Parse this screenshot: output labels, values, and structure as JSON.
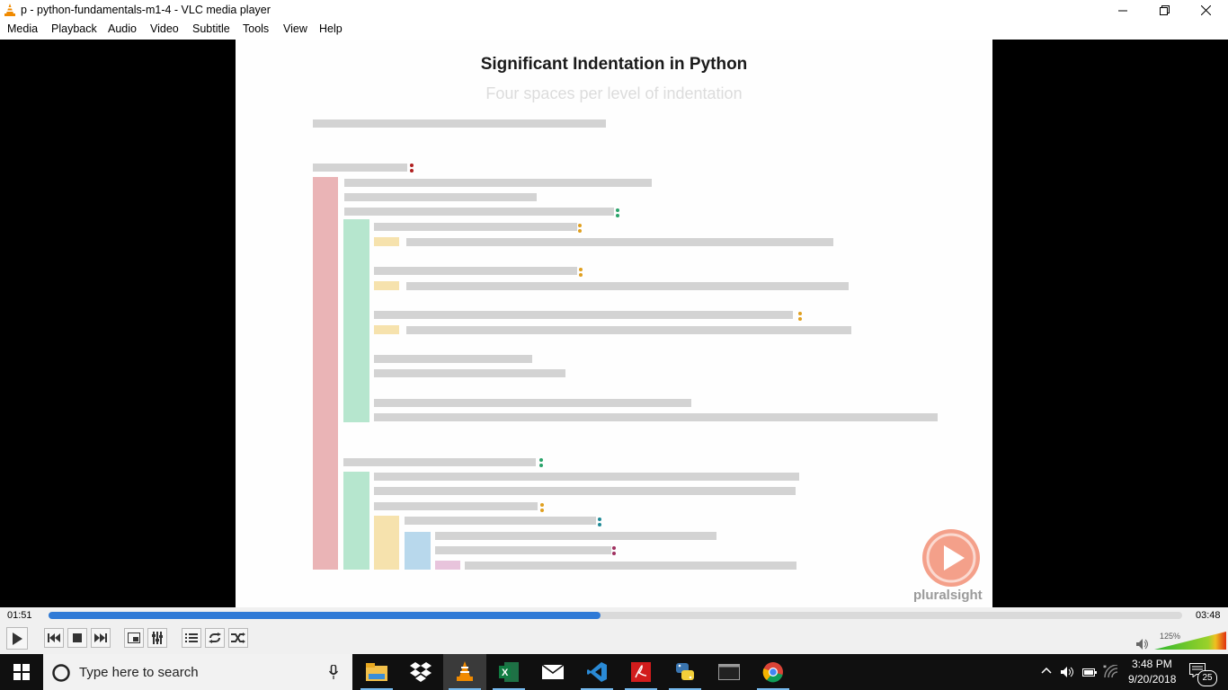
{
  "window": {
    "title": "p - python-fundamentals-m1-4 - VLC media player",
    "logo_icon": "vlc-cone-icon",
    "buttons": [
      "minimize-icon",
      "maximize-icon",
      "close-icon"
    ]
  },
  "menu": {
    "items": [
      "Media",
      "Playback",
      "Audio",
      "Video",
      "Subtitle",
      "Tools",
      "View",
      "Help"
    ]
  },
  "slide": {
    "title": "Significant Indentation in Python",
    "subtitle": "Four spaces per level of indentation",
    "brand": "pluralsight",
    "block_colors": {
      "level1": "#eab4b6",
      "level2": "#b6e6ce",
      "level3": "#f6e2ad",
      "level4": "#b8d8ec",
      "level5": "#e8c4dc",
      "line": "#d3d3d3"
    },
    "dot_colors": {
      "red": "#b02020",
      "green": "#2aa36a",
      "yellow": "#e0a020",
      "teal": "#208a96",
      "purple": "#a03060"
    }
  },
  "player": {
    "elapsed": "01:51",
    "total": "03:48",
    "progress_fraction": 0.487,
    "volume_label": "125%",
    "volume_fraction": 1.0,
    "accent_color": "#2f7ad6",
    "buttons": [
      "play-icon",
      "previous-icon",
      "stop-icon",
      "next-icon",
      "fullscreen-icon",
      "extended-settings-icon",
      "playlist-icon",
      "loop-icon",
      "shuffle-icon"
    ]
  },
  "taskbar": {
    "search_placeholder": "Type here to search",
    "apps": [
      "file-explorer-icon",
      "dropbox-icon",
      "vlc-icon",
      "excel-icon",
      "mail-icon",
      "vscode-icon",
      "acrobat-icon",
      "python-icon",
      "terminal-icon",
      "chrome-icon"
    ],
    "active_app": "vlc-icon",
    "time": "3:48 PM",
    "date": "9/20/2018",
    "notifications_count": "25"
  }
}
